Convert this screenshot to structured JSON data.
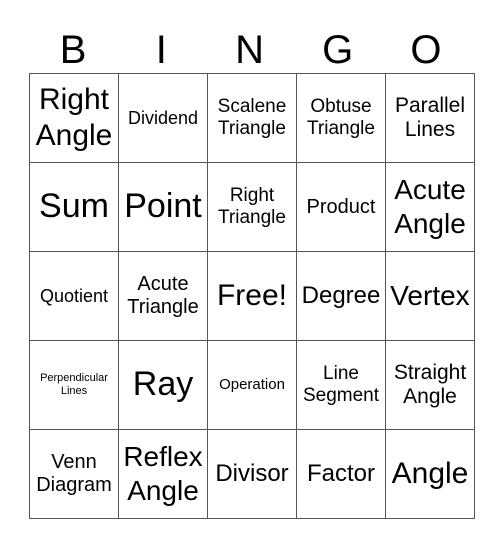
{
  "header": [
    "B",
    "I",
    "N",
    "G",
    "O"
  ],
  "rows": [
    [
      "Right Angle",
      "Dividend",
      "Scalene Triangle",
      "Obtuse Triangle",
      "Parallel Lines"
    ],
    [
      "Sum",
      "Point",
      "Right Triangle",
      "Product",
      "Acute Angle"
    ],
    [
      "Quotient",
      "Acute Triangle",
      "Free!",
      "Degree",
      "Vertex"
    ],
    [
      "Perpendicular Lines",
      "Ray",
      "Operation",
      "Line Segment",
      "Straight Angle"
    ],
    [
      "Venn Diagram",
      "Reflex Angle",
      "Divisor",
      "Factor",
      "Angle"
    ]
  ]
}
